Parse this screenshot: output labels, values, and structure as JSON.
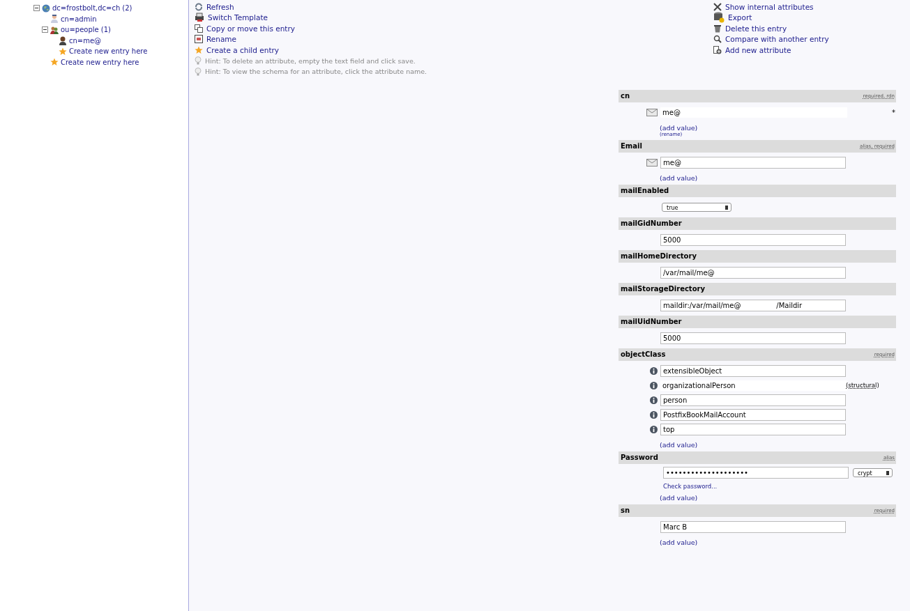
{
  "tree": [
    {
      "label": "dc=frostbolt,dc=ch",
      "count": "(2)",
      "kind": "globe",
      "expanded": true,
      "children": [
        {
          "label": "cn=admin",
          "kind": "user"
        },
        {
          "label": "ou=people",
          "count": "(1)",
          "kind": "group",
          "expanded": true,
          "children": [
            {
              "label": "cn=me@",
              "kind": "person"
            },
            {
              "label": "Create new entry here",
              "kind": "star"
            }
          ]
        },
        {
          "label": "Create new entry here",
          "kind": "star"
        }
      ]
    }
  ],
  "actions_left": [
    {
      "label": "Refresh",
      "kind": "refresh"
    },
    {
      "label": "Switch Template",
      "kind": "template"
    },
    {
      "label": "Copy or move this entry",
      "kind": "copy"
    },
    {
      "label": "Rename",
      "kind": "rename"
    },
    {
      "label": "Create a child entry",
      "kind": "star"
    },
    {
      "label": "Hint: To delete an attribute, empty the text field and click save.",
      "kind": "hint"
    },
    {
      "label": "Hint: To view the schema for an attribute, click the attribute name.",
      "kind": "hint"
    }
  ],
  "actions_right": [
    {
      "label": "Show internal attributes",
      "kind": "tools"
    },
    {
      "label": "Export",
      "kind": "export"
    },
    {
      "label": "Delete this entry",
      "kind": "trash"
    },
    {
      "label": "Compare with another entry",
      "kind": "compare"
    },
    {
      "label": "Add new attribute",
      "kind": "add"
    }
  ],
  "attributes": [
    {
      "name": "cn",
      "kind": "mail",
      "flags": "required, rdn",
      "values": [
        {
          "kind": "static",
          "value": "me@",
          "marker": "*"
        }
      ],
      "links": [
        "(add value)"
      ],
      "sublink": "(rename)"
    },
    {
      "name": "Email",
      "kind": "mail",
      "flags": "alias, required",
      "values": [
        {
          "kind": "text",
          "value": "me@"
        }
      ],
      "links": [
        "(add value)"
      ]
    },
    {
      "name": "mailEnabled",
      "kind": "plain",
      "values": [
        {
          "kind": "select",
          "value": "true"
        }
      ]
    },
    {
      "name": "mailGidNumber",
      "kind": "plain",
      "values": [
        {
          "kind": "text",
          "value": "5000"
        }
      ]
    },
    {
      "name": "mailHomeDirectory",
      "kind": "plain",
      "values": [
        {
          "kind": "text",
          "value": "/var/mail/me@"
        }
      ]
    },
    {
      "name": "mailStorageDirectory",
      "kind": "plain",
      "values": [
        {
          "kind": "text",
          "value": "maildir:/var/mail/me@                /Maildir"
        }
      ]
    },
    {
      "name": "mailUidNumber",
      "kind": "plain",
      "values": [
        {
          "kind": "text",
          "value": "5000"
        }
      ]
    },
    {
      "name": "objectClass",
      "kind": "info",
      "flags": "required",
      "values": [
        {
          "kind": "text",
          "value": "extensibleObject"
        },
        {
          "kind": "static",
          "value": "organizationalPerson",
          "note": "(structural)"
        },
        {
          "kind": "text",
          "value": "person"
        },
        {
          "kind": "text",
          "value": "PostfixBookMailAccount"
        },
        {
          "kind": "text",
          "value": "top"
        }
      ],
      "links": [
        "(add value)"
      ]
    },
    {
      "name": "Password",
      "kind": "plain",
      "flags": "alias",
      "values": [
        {
          "kind": "password",
          "value": "••••••••••••••••••••",
          "hash": "crypt",
          "check": "Check password..."
        }
      ],
      "links": [
        "(add value)"
      ]
    },
    {
      "name": "sn",
      "kind": "plain",
      "flags": "required",
      "values": [
        {
          "kind": "text",
          "value": "Marc B"
        }
      ],
      "links": [
        "(add value)"
      ]
    }
  ]
}
